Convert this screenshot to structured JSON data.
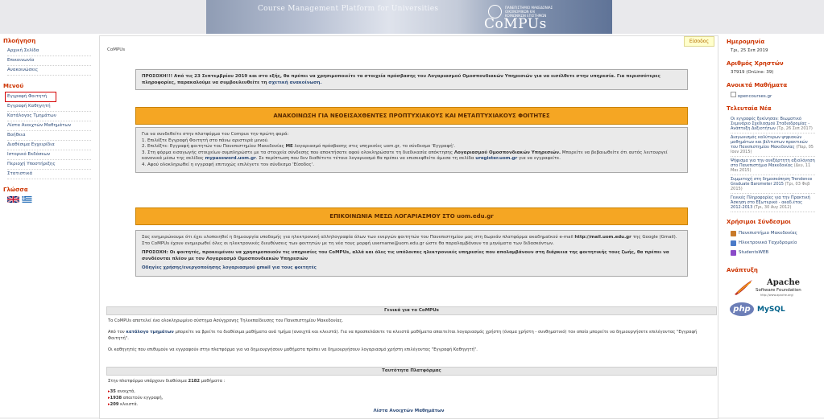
{
  "banner": {
    "subtitle": "Course Management Platform for Universities",
    "logo_text": "CoMPUs",
    "university": "ΠΑΝΕΠΙΣΤΗΜΙΟ ΜΑΚΕΔΟΝΙΑΣ ΟΙΚΟΝΟΜΙΚΩΝ ΚΑΙ ΚΟΙΝΩΝΙΚΩΝ ΕΠΙΣΤΗΜΩΝ"
  },
  "left": {
    "nav_title": "Πλοήγηση",
    "nav_items": [
      "Αρχική Σελίδα",
      "Επικοινωνία",
      "Ανακοινώσεις"
    ],
    "menu_title": "Μενού",
    "menu_items": [
      "Εγγραφή Φοιτητή",
      "Εγγραφή Καθηγητή",
      "Κατάλογος Τμημάτων",
      "Λίστα Ανοιχτών Μαθημάτων",
      "Βοήθεια",
      "Διαθέσιμα Εγχειρίδια",
      "Ιστορικό Εκδόσεων",
      "Περιοχή Υποστήριξης",
      "Στατιστικά"
    ],
    "lang_title": "Γλώσσα"
  },
  "center": {
    "breadcrumb": "CoMPUs",
    "login": "Είσοδος",
    "notice1": {
      "bold": "ΠΡΟΣΟΧΗ!!! Από τις 23 Σεπτεμβρίου 2019 και στο εξής, θα πρέπει να χρησιμοποιείτε τα στοιχεία πρόσβασης του Λογαριασμού Ομοσπονδιακών Υπηρεσιών για να εισέλθετε στην υπηρεσία. Για περισσότερες πληροφορίες, παρακαλούμε να συμβουλευθείτε τη",
      "link": "σχετική ανακοίνωση."
    },
    "orange1": "ΑΝΑΚΟΙΝΩΣΗ ΓΙΑ ΝΕΟΕΙΣΑΧΘΕΝΤΕΣ ΠΡΟΠΤΥΧΙΑΚΟΥΣ ΚΑΙ ΜΕΤΑΠΤΥΧΙΑΚΟΥΣ ΦΟΙΤΗΤΕΣ",
    "box2": {
      "intro": "Για να συνδεθείτε στην πλατφόρμα του Compus την πρώτη φορά:",
      "step1": "1. Επιλέξτε Εγγραφή Φοιτητή στο πάνω αριστερά μενού.",
      "step2a": "2. Επιλέξτε: Εγγραφή φοιτητών του Πανεπιστημίου Μακεδονίας",
      "step2b": "ΜΕ",
      "step2c": "λογαριασμό πρόσβασης στις υπηρεσίες uom.gr, το σύνδεσμο 'Εγγραφή'.",
      "step3a": "3. Στη φόρμα εισαγωγής στοιχείων συμπληρώστε με τα στοιχεία σύνδεσης που αποκτήσατε αφού ολοκληρώσατε τη διαδικασία απόκτησης",
      "step3b": "Λογαριασμού Ομοσπονδιακών Υπηρεσιών.",
      "step3c": "Μπορείτε να βεβαιωθείτε ότι αυτός λειτουργεί κανονικά μέσω της σελίδας",
      "step3d": "mypassword.uom.gr",
      "step3e": ". Σε περίπτωση που δεν διαθέτετε τέτοιο λογαριασμό θα πρέπει να επισκεφθείτε άμεσα τη σελίδα",
      "step3f": "uregister.uom.gr",
      "step3g": "για να εγγραφείτε.",
      "step4": "4. Αφού ολοκληρωθεί η εγγραφή επιτυχώς επιλέγετε τον σύνδεσμο 'Είσοδος'."
    },
    "orange2": "ΕΠΙΚΟΙΝΩΝΙΑ ΜΕΣΩ ΛΟΓΑΡΙΑΣΜΟΥ ΣΤΟ uom.edu.gr",
    "box3": {
      "p1a": "Σας ενημερώνουμε ότι έχει υλοποιηθεί η δημιουργία υποδομής για ηλεκτρονική αλληλογραφία όλων των ενεργών φοιτητών του Πανεπιστημίου μας στη δωρεάν πλατφόρμα ακαδημαϊκού e-mail",
      "p1b": "http://mail.uom.edu.gr",
      "p1c": "της Google (Gmail). Στο CoMPUs έχουν ενημερωθεί όλες οι ηλεκτρονικές διευθύνσεις των φοιτητών με τη νέα τους μορφή username@uom.edu.gr ώστε θα παραλαμβάνουν τα μηνύματα των διδασκόντων.",
      "p2": "ΠΡΟΣΟΧΗ: Οι φοιτητές, προκειμένου να χρησιμοποιούν τις υπηρεσίες του CoMPUs, αλλά και όλες τις υπόλοιπες ηλεκτρονικές υπηρεσίες που απολαμβάνουν στη διάρκεια της φοιτητικής τους ζωής, θα πρέπει να συνδέονται πλέον με τον Λογαριασμό Ομοσπονδιακών Υπηρεσιών",
      "link": "Οδηγίες χρήσης/ενεργοποίησης λογαριασμού gmail για τους φοιτητές"
    },
    "general_header": "Γενικά για το CoMPUs",
    "general_p1": "Το CoMPUs αποτελεί ένα ολοκληρωμένο σύστημα Ασύγχρονης Τηλεκπαίδευσης του Πανεπιστημίου Μακεδονίας.",
    "general_p2a": "Από τον",
    "general_p2b": "κατάλογο τμημάτων",
    "general_p2c": "μπορείτε να βρείτε τα διαθέσιμα μαθήματα ανά τμήμα (ανοιχτά και κλειστά). Για να προσπελάσετε τα κλειστά μαθήματα απαιτείται λογαριασμός χρήστη (όνομα χρήστη - συνθηματικό) τον οποίο μπορείτε να δημιουργήσετε επιλέγοντας \"Εγγραφή Φοιτητή\".",
    "general_p3": "Οι καθηγητές που επιθυμούν να εγγραφούν στην πλατφόρμα για να δημιουργήσουν μαθήματα πρέπει να δημιουργήσουν λογαριασμό χρήστη επιλέγοντας \"Εγγραφή Καθηγητή\".",
    "identity_header": "Ταυτότητα Πλατφόρμας",
    "identity_p1a": "Στην πλατφόρμα υπάρχουν διαθέσιμα",
    "identity_p1b": "2182",
    "identity_p1c": "μαθήματα :",
    "stats": [
      {
        "num": "35",
        "label": "ανοιχτά,"
      },
      {
        "num": "1938",
        "label": "απαιτούν εγγραφή,"
      },
      {
        "num": "209",
        "label": "κλειστά."
      }
    ],
    "open_courses_link": "Λίστα Ανοιχτών Μαθημάτων"
  },
  "right": {
    "date_title": "Ημερομηνία",
    "date_value": "Τρι, 25 Σεπ 2019",
    "users_title": "Αριθμός Χρηστών",
    "users_value": "37919 (OnLine: 39)",
    "open_title": "Ανοικτά Μαθήματα",
    "open_img_alt": "opencourses.gr",
    "news_title": "Τελευταία Νέα",
    "news": [
      {
        "text": "Οι εγγραφές ξεκίνησαν: Βιωματικό Σεμινάριο Σχεδιασμού Σταδιοδρομίας - Ανάπτυξη Δεξιοτήτων",
        "date": "(Τρ, 26 Σεπ 2017)"
      },
      {
        "text": "Διαγωνισμός καλύτερων ψηφιακών μαθημάτων και βέλτιστων πρακτικών του Πανεπιστημίου Μακεδονίας",
        "date": "(Παρ, 05 Ιουν 2015)"
      },
      {
        "text": "Ψήφισμα για την ανεξάρτητη αξιολόγηση στο Πανεπιστήμιο Μακεδονίας",
        "date": "(Δευ, 11 Μαι 2015)"
      },
      {
        "text": "Συμμετοχή στη δημοσκόπηση Trendence Graduate Barometer 2015",
        "date": "(Τρι, 03 Φεβ 2015)"
      },
      {
        "text": "Γενικές Πληροφορίες για την Πρακτική Άσκηση στο Εξωτερικό - ακαδ.έτος 2012-2013",
        "date": "(Τρι, 30 Αυγ 2012)"
      }
    ],
    "links_title": "Χρήσιμοι Σύνδεσμοι",
    "links": [
      "Πανεπιστήμιο Μακεδονίας",
      "Ηλεκτρονικό Ταχυδρομείο",
      "StudentsWEB"
    ],
    "powered_title": "Ανάπτυξη",
    "apache_text": "Apache",
    "apache_sub": "Software Foundation",
    "apache_url": "http://www.apache.org/",
    "php_text": "php",
    "mysql_text": "MySQL"
  }
}
